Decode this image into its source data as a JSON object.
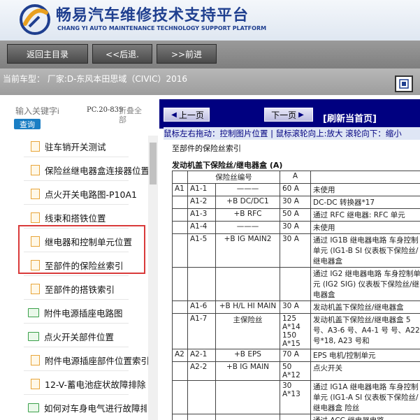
{
  "header": {
    "title_cn": "畅易汽车维修技术支持平台",
    "title_en": "CHANG YI AUTO MAINTENANCE TECHNOLOGY SUPPORT PLATFORM",
    "brand_color": "#1f3f8f"
  },
  "nav": {
    "home_label": "返回主目录",
    "back_label": "<<后退.",
    "forward_label": ">>前进"
  },
  "vehicle": {
    "label": "当前车型：  厂家:D-东风本田思域（CIVIC）2016"
  },
  "sidebar": {
    "search_placeholder": "输入关键字i",
    "search_button": "查询",
    "pc_label": "PC.20-839",
    "collapse_label": "折叠全部",
    "items": [
      {
        "label": "驻车销开关测试",
        "icon": "file-icon"
      },
      {
        "label": "保险丝继电器盒连接器位置",
        "icon": "file-icon"
      },
      {
        "label": "点火开关电路图-P10A1",
        "icon": "file-icon"
      },
      {
        "label": "线束和搭铁位置",
        "icon": "file-icon"
      },
      {
        "label": "继电器和控制单元位置",
        "icon": "file-icon"
      },
      {
        "label": "至部件的保险丝索引",
        "icon": "file-icon"
      },
      {
        "label": "至部件的搭铁索引",
        "icon": "file-icon"
      },
      {
        "label": "附件电源插座电路图",
        "icon": "folder-icon"
      },
      {
        "label": "点火开关部件位置",
        "icon": "folder-icon"
      },
      {
        "label": "附件电源插座部件位置索引",
        "icon": "file-icon"
      },
      {
        "label": "12-V-蓄电池症状故障排除",
        "icon": "file-icon"
      },
      {
        "label": "如何对车身电气进行故障排除",
        "icon": "folder-icon"
      }
    ]
  },
  "content": {
    "prev_label": "上一页",
    "next_label": "下一页",
    "refresh_label": "[刷新当首页]",
    "hint": "鼠标左右拖动：控制图片位置 | 鼠标滚轮向上:放大  滚轮向下：缩小",
    "doc_title": "至部件的保险丝索引",
    "doc_subtitle": "发动机盖下保险丝/继电器盒 (A)",
    "table_headers": [
      "保险丝编号",
      "A",
      ""
    ],
    "rows": [
      {
        "g": "A1",
        "n": "A1-1",
        "d": "———",
        "a": "60 A",
        "desc": "未使用"
      },
      {
        "g": "",
        "n": "A1-2",
        "d": "+B DC/DC1",
        "a": "30 A",
        "desc": "DC-DC 转换器*17"
      },
      {
        "g": "",
        "n": "A1-3",
        "d": "+B RFC",
        "a": "50 A",
        "desc": "通过 RFC 继电器: RFC 单元"
      },
      {
        "g": "",
        "n": "A1-4",
        "d": "———",
        "a": "30 A",
        "desc": "未使用"
      },
      {
        "g": "",
        "n": "A1-5",
        "d": "+B IG MAIN2",
        "a": "30 A",
        "desc": "通过 IG1B 继电器电路 车身控制单元 (IG1-B SI 仪表板下保险丝/继电器盒"
      },
      {
        "g": "",
        "n": "",
        "d": "",
        "a": "",
        "desc": "通过 IG2 继电器电路 车身控制单元 (IG2 SIG) 仪表板下保险丝/继电器盒"
      },
      {
        "g": "",
        "n": "A1-6",
        "d": "+B H/L HI MAIN",
        "a": "30 A",
        "desc": "发动机盖下保险丝/继电器盒"
      },
      {
        "g": "",
        "n": "A1-7",
        "d": "主保险丝",
        "a": "125 A*14 150 A*15",
        "desc": "发动机盖下保险丝/继电器盒 5 号、A3-6 号、A4-1 号 号、A22 号*18, A23 号和"
      },
      {
        "g": "A2",
        "n": "A2-1",
        "d": "+B EPS",
        "a": "70 A",
        "desc": "EPS 电机/控制单元"
      },
      {
        "g": "",
        "n": "A2-2",
        "d": "+B IG MAIN",
        "a": "50 A*12",
        "desc": "点火开关"
      },
      {
        "g": "",
        "n": "",
        "d": "",
        "a": "30 A*13",
        "desc": "通过 IG1A 继电器电路 车身控制单元 (IG1-A SI 仪表板下保险丝/继电器盒 险丝"
      },
      {
        "g": "",
        "n": "",
        "d": "",
        "a": "",
        "desc": "通过 ACC 继电器电路"
      }
    ]
  }
}
